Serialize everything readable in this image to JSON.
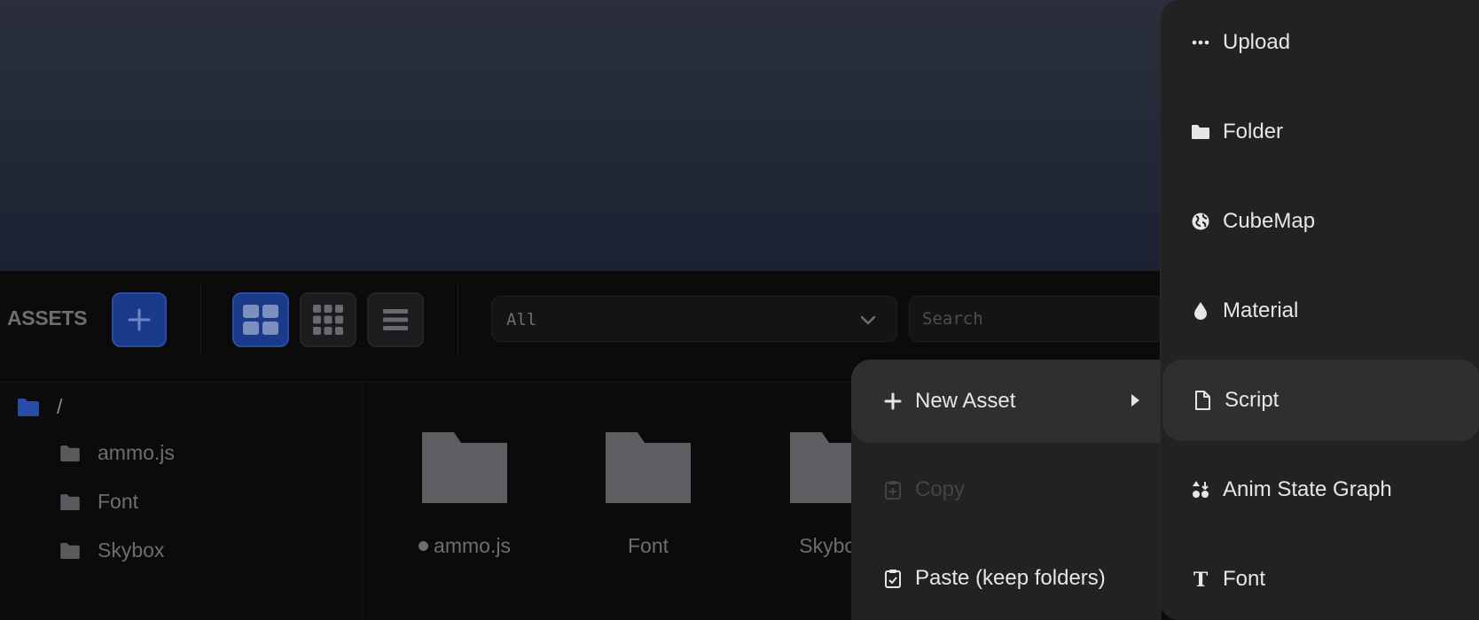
{
  "assets_panel": {
    "title": "ASSETS",
    "filter": {
      "selected": "All"
    },
    "search": {
      "placeholder": "Search"
    },
    "tree": {
      "root_label": "/",
      "items": [
        {
          "label": "ammo.js"
        },
        {
          "label": "Font"
        },
        {
          "label": "Skybox"
        }
      ]
    },
    "grid": {
      "items": [
        {
          "label": "ammo.js",
          "dot": true
        },
        {
          "label": "Font"
        },
        {
          "label": "Skybox"
        }
      ]
    }
  },
  "context_menu": {
    "items": [
      {
        "label": "New Asset",
        "icon": "plus-icon",
        "has_submenu": true,
        "highlighted": true
      },
      {
        "label": "Copy",
        "icon": "clipboard-icon",
        "disabled": true
      },
      {
        "label": "Paste (keep folders)",
        "icon": "clipboard-check-icon"
      }
    ]
  },
  "submenu": {
    "items": [
      {
        "label": "Upload",
        "icon": "dots-icon"
      },
      {
        "label": "Folder",
        "icon": "folder-icon"
      },
      {
        "label": "CubeMap",
        "icon": "globe-icon"
      },
      {
        "label": "Material",
        "icon": "droplet-icon"
      },
      {
        "label": "Script",
        "icon": "file-icon",
        "highlighted": true
      },
      {
        "label": "Anim State Graph",
        "icon": "anim-graph-icon"
      },
      {
        "label": "Font",
        "icon": "text-t-icon"
      }
    ]
  },
  "colors": {
    "accent": "#1c3a8a",
    "menu_bg": "#222224",
    "menu_highlight": "#2f2f32"
  }
}
